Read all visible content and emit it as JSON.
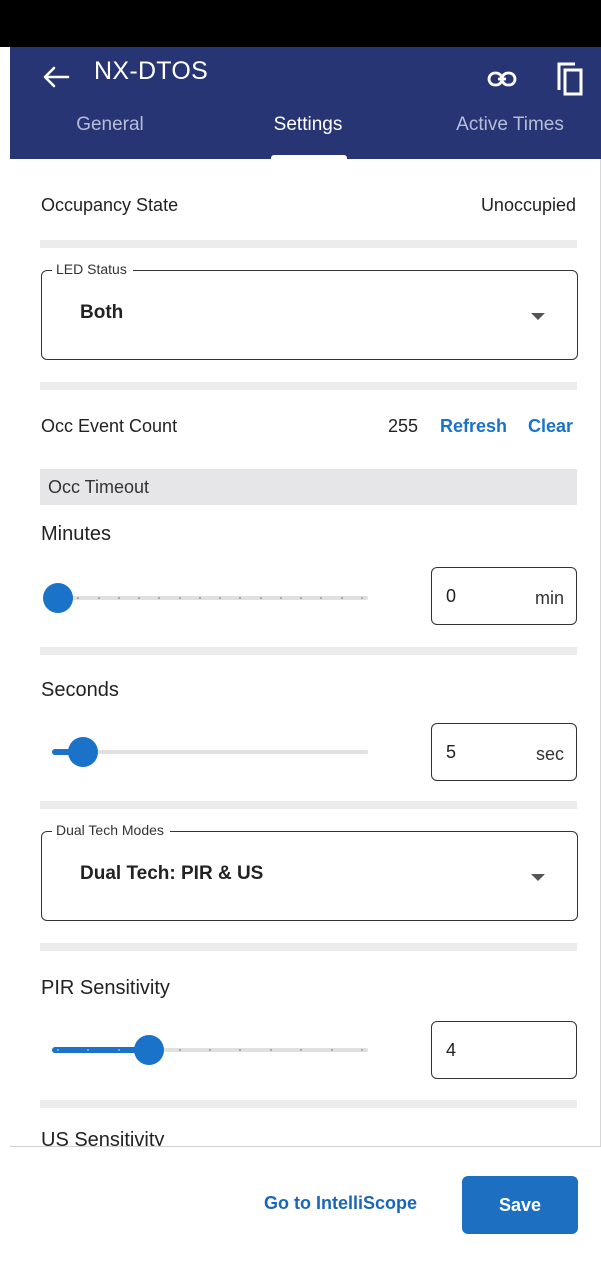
{
  "header": {
    "title": "NX-DTOS",
    "icons": {
      "back": "arrow-left-icon",
      "link": "link-icon",
      "copy": "copy-icon"
    },
    "accent_color": "#283574"
  },
  "tabs": [
    {
      "label": "General",
      "active": false
    },
    {
      "label": "Settings",
      "active": true
    },
    {
      "label": "Active Times",
      "active": false
    }
  ],
  "occupancy": {
    "label": "Occupancy State",
    "value": "Unoccupied"
  },
  "led_status": {
    "legend": "LED Status",
    "value": "Both"
  },
  "occ_event": {
    "label": "Occ Event Count",
    "count": "255",
    "refresh_label": "Refresh",
    "clear_label": "Clear"
  },
  "occ_timeout": {
    "section_label": "Occ Timeout",
    "minutes": {
      "label": "Minutes",
      "value": "0",
      "unit": "min",
      "slider_fraction": 0.0
    },
    "seconds": {
      "label": "Seconds",
      "value": "5",
      "unit": "sec",
      "slider_fraction": 0.083
    }
  },
  "dual_tech": {
    "legend": "Dual Tech Modes",
    "value": "Dual Tech: PIR & US"
  },
  "pir_sensitivity": {
    "label": "PIR Sensitivity",
    "value": "4",
    "slider_fraction": 0.3
  },
  "us_sensitivity": {
    "label": "US Sensitivity"
  },
  "footer": {
    "goto_label": "Go to IntelliScope",
    "save_label": "Save",
    "button_color": "#1d6fc2"
  }
}
